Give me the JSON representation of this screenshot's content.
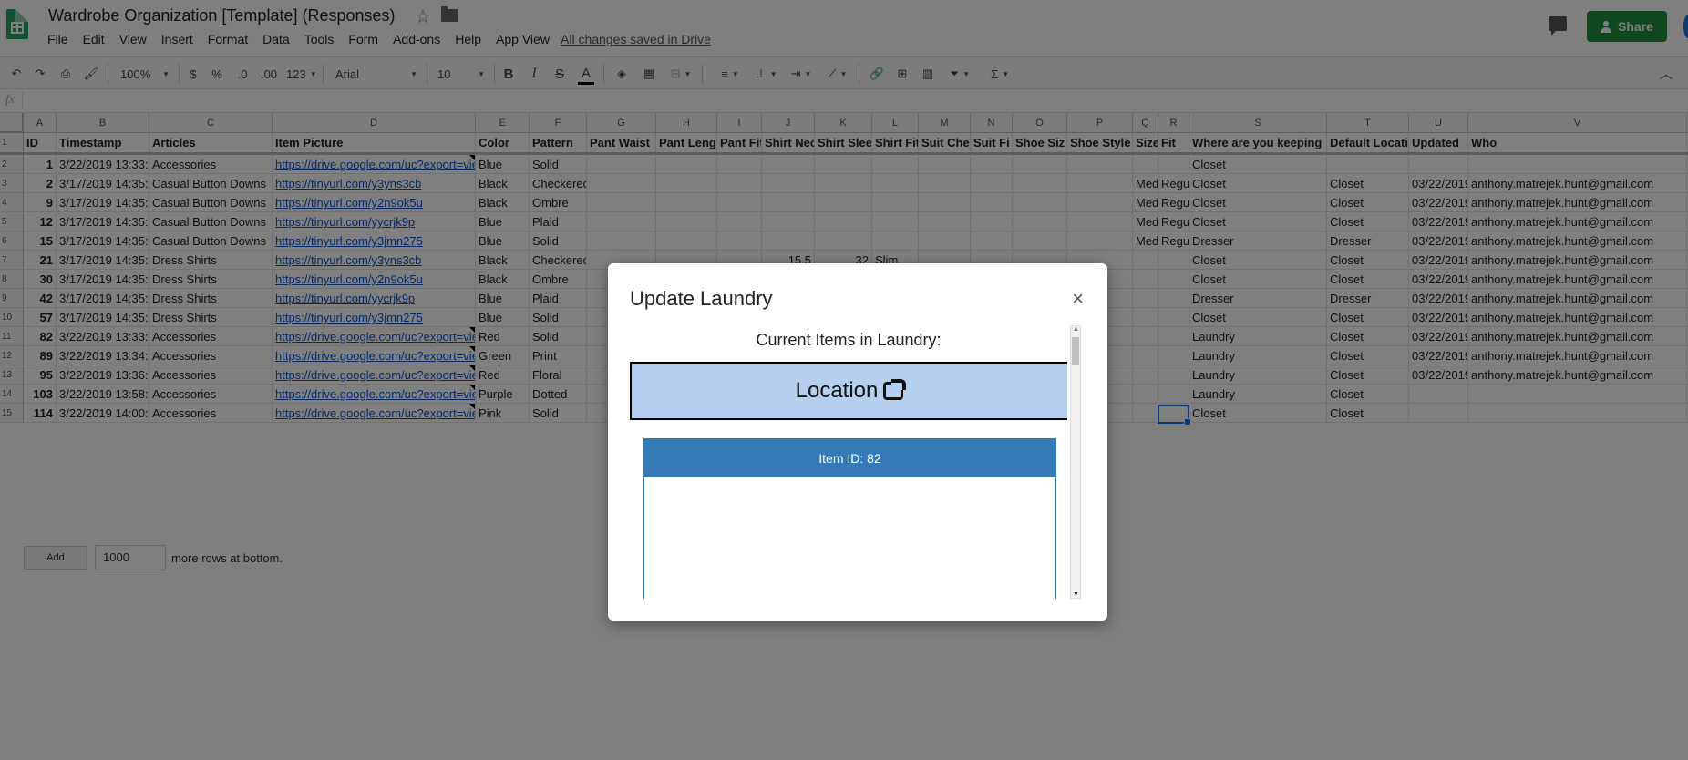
{
  "header": {
    "doc_title": "Wardrobe Organization [Template] (Responses)",
    "menu": [
      "File",
      "Edit",
      "View",
      "Insert",
      "Format",
      "Data",
      "Tools",
      "Form",
      "Add-ons",
      "Help",
      "App View"
    ],
    "saved_status": "All changes saved in Drive",
    "share_label": "Share"
  },
  "toolbar": {
    "zoom": "100%",
    "currency": "$",
    "percent": "%",
    "decimal_decrease": ".0",
    "decimal_increase": ".00",
    "more_formats": "123",
    "font": "Arial",
    "font_size": "10",
    "bold": "B",
    "italic": "I",
    "strike": "S",
    "text_color": "A",
    "sigma": "Σ"
  },
  "formula_bar": {
    "fx": "fx"
  },
  "grid": {
    "columns": [
      "A",
      "B",
      "C",
      "D",
      "E",
      "F",
      "G",
      "H",
      "I",
      "J",
      "K",
      "L",
      "M",
      "N",
      "O",
      "P",
      "Q",
      "R",
      "S",
      "T",
      "U",
      "V"
    ],
    "row_numbers": [
      "1",
      "2",
      "3",
      "4",
      "5",
      "6",
      "7",
      "8",
      "9",
      "10",
      "11",
      "12",
      "13",
      "14",
      "15"
    ],
    "header_row": [
      "ID",
      "Timestamp",
      "Articles",
      "Item Picture",
      "Color",
      "Pattern",
      "Pant Waist",
      "Pant Leng",
      "Pant Fit",
      "Shirt Nec",
      "Shirt Slee",
      "Shirt Fit",
      "Suit Che",
      "Suit Fi",
      "Shoe Siz",
      "Shoe Style",
      "Size",
      "Fit",
      "Where are you keeping",
      "Default Locati",
      "Updated",
      "Who"
    ],
    "rows": [
      [
        "1",
        "3/22/2019 13:33:",
        "Accessories",
        "https://drive.google.com/uc?export=vie",
        "Blue",
        "Solid",
        "",
        "",
        "",
        "",
        "",
        "",
        "",
        "",
        "",
        "",
        "",
        "",
        "Closet",
        "",
        "",
        ""
      ],
      [
        "2",
        "3/17/2019 14:35:",
        "Casual Button Downs",
        "https://tinyurl.com/y3yns3cb",
        "Black",
        "Checkered",
        "",
        "",
        "",
        "",
        "",
        "",
        "",
        "",
        "",
        "",
        "Med",
        "Regu",
        "Closet",
        "Closet",
        "03/22/2019",
        "anthony.matrejek.hunt@gmail.com"
      ],
      [
        "9",
        "3/17/2019 14:35:",
        "Casual Button Downs",
        "https://tinyurl.com/y2n9ok5u",
        "Black",
        "Ombre",
        "",
        "",
        "",
        "",
        "",
        "",
        "",
        "",
        "",
        "",
        "Med",
        "Regu",
        "Closet",
        "Closet",
        "03/22/2019",
        "anthony.matrejek.hunt@gmail.com"
      ],
      [
        "12",
        "3/17/2019 14:35:",
        "Casual Button Downs",
        "https://tinyurl.com/yycrjk9p",
        "Blue",
        "Plaid",
        "",
        "",
        "",
        "",
        "",
        "",
        "",
        "",
        "",
        "",
        "Med",
        "Regu",
        "Closet",
        "Closet",
        "03/22/2019",
        "anthony.matrejek.hunt@gmail.com"
      ],
      [
        "15",
        "3/17/2019 14:35:",
        "Casual Button Downs",
        "https://tinyurl.com/y3jmn275",
        "Blue",
        "Solid",
        "",
        "",
        "",
        "",
        "",
        "",
        "",
        "",
        "",
        "",
        "Med",
        "Regu",
        "Dresser",
        "Dresser",
        "03/22/2019",
        "anthony.matrejek.hunt@gmail.com"
      ],
      [
        "21",
        "3/17/2019 14:35:",
        "Dress Shirts",
        "https://tinyurl.com/y3yns3cb",
        "Black",
        "Checkered",
        "",
        "",
        "",
        "15.5",
        "32",
        "Slim",
        "",
        "",
        "",
        "",
        "",
        "",
        "Closet",
        "Closet",
        "03/22/2019",
        "anthony.matrejek.hunt@gmail.com"
      ],
      [
        "30",
        "3/17/2019 14:35:",
        "Dress Shirts",
        "https://tinyurl.com/y2n9ok5u",
        "Black",
        "Ombre",
        "",
        "",
        "",
        "",
        "",
        "",
        "",
        "",
        "",
        "",
        "",
        "",
        "Closet",
        "Closet",
        "03/22/2019",
        "anthony.matrejek.hunt@gmail.com"
      ],
      [
        "42",
        "3/17/2019 14:35:",
        "Dress Shirts",
        "https://tinyurl.com/yycrjk9p",
        "Blue",
        "Plaid",
        "",
        "",
        "",
        "",
        "",
        "",
        "",
        "",
        "",
        "",
        "",
        "",
        "Dresser",
        "Dresser",
        "03/22/2019",
        "anthony.matrejek.hunt@gmail.com"
      ],
      [
        "57",
        "3/17/2019 14:35:",
        "Dress Shirts",
        "https://tinyurl.com/y3jmn275",
        "Blue",
        "Solid",
        "",
        "",
        "",
        "",
        "",
        "",
        "",
        "",
        "",
        "",
        "",
        "",
        "Closet",
        "Closet",
        "03/22/2019",
        "anthony.matrejek.hunt@gmail.com"
      ],
      [
        "82",
        "3/22/2019 13:33:",
        "Accessories",
        "https://drive.google.com/uc?export=vie",
        "Red",
        "Solid",
        "",
        "",
        "",
        "",
        "",
        "",
        "",
        "",
        "",
        "",
        "",
        "",
        "Laundry",
        "Closet",
        "03/22/2019",
        "anthony.matrejek.hunt@gmail.com"
      ],
      [
        "89",
        "3/22/2019 13:34:",
        "Accessories",
        "https://drive.google.com/uc?export=vie",
        "Green",
        "Print",
        "",
        "",
        "",
        "",
        "",
        "",
        "",
        "",
        "",
        "",
        "",
        "",
        "Laundry",
        "Closet",
        "03/22/2019",
        "anthony.matrejek.hunt@gmail.com"
      ],
      [
        "95",
        "3/22/2019 13:36:",
        "Accessories",
        "https://drive.google.com/uc?export=vie",
        "Red",
        "Floral",
        "",
        "",
        "",
        "",
        "",
        "",
        "",
        "",
        "",
        "",
        "",
        "",
        "Laundry",
        "Closet",
        "03/22/2019",
        "anthony.matrejek.hunt@gmail.com"
      ],
      [
        "103",
        "3/22/2019 13:58:",
        "Accessories",
        "https://drive.google.com/uc?export=vie",
        "Purple",
        "Dotted",
        "",
        "",
        "",
        "",
        "",
        "",
        "",
        "",
        "",
        "",
        "",
        "",
        "Laundry",
        "Closet",
        "",
        ""
      ],
      [
        "114",
        "3/22/2019 14:00:",
        "Accessories",
        "https://drive.google.com/uc?export=vie",
        "Pink",
        "Solid",
        "",
        "",
        "",
        "",
        "",
        "",
        "",
        "",
        "",
        "",
        "",
        "",
        "Closet",
        "Closet",
        "",
        ""
      ]
    ]
  },
  "add_rows": {
    "button_label": "Add",
    "count": "1000",
    "suffix": "more rows at bottom."
  },
  "dialog": {
    "title": "Update Laundry",
    "close": "×",
    "heading": "Current Items in Laundry:",
    "location_label": "Location",
    "item_header": "Item ID: 82"
  }
}
